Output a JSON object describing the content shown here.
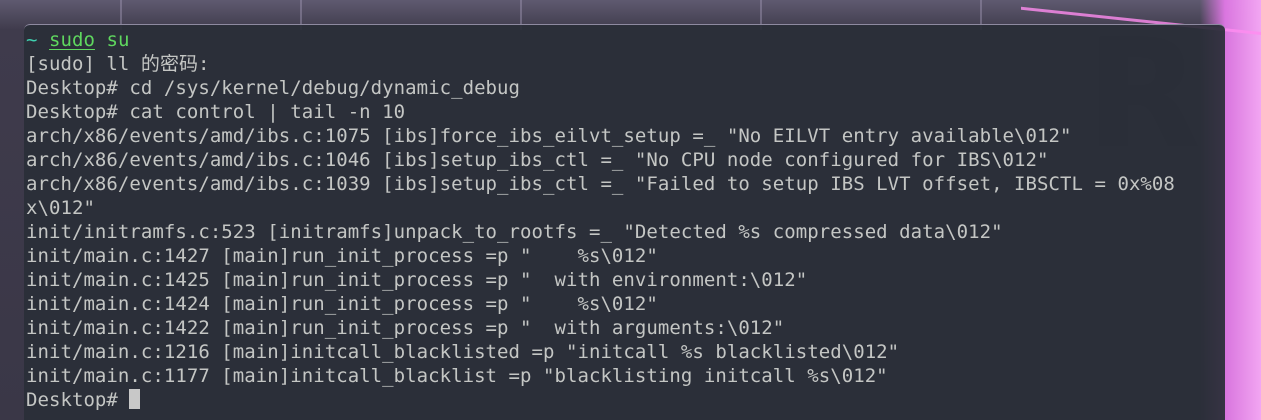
{
  "terminal": {
    "first_line": {
      "prompt": "~",
      "command": "sudo",
      "argument": "su"
    },
    "lines": [
      "[sudo] ll 的密码:",
      "Desktop# cd /sys/kernel/debug/dynamic_debug",
      "Desktop# cat control | tail -n 10",
      "arch/x86/events/amd/ibs.c:1075 [ibs]force_ibs_eilvt_setup =_ \"No EILVT entry available\\012\"",
      "arch/x86/events/amd/ibs.c:1046 [ibs]setup_ibs_ctl =_ \"No CPU node configured for IBS\\012\"",
      "arch/x86/events/amd/ibs.c:1039 [ibs]setup_ibs_ctl =_ \"Failed to setup IBS LVT offset, IBSCTL = 0x%08",
      "x\\012\"",
      "init/initramfs.c:523 [initramfs]unpack_to_rootfs =_ \"Detected %s compressed data\\012\"",
      "init/main.c:1427 [main]run_init_process =p \"    %s\\012\"",
      "init/main.c:1425 [main]run_init_process =p \"  with environment:\\012\"",
      "init/main.c:1424 [main]run_init_process =p \"    %s\\012\"",
      "init/main.c:1422 [main]run_init_process =p \"  with arguments:\\012\"",
      "init/main.c:1216 [main]initcall_blacklisted =p \"initcall %s blacklisted\\012\"",
      "init/main.c:1177 [main]initcall_blacklist =p \"blacklisting initcall %s\\012\""
    ],
    "current_prompt": "Desktop# ",
    "colors": {
      "background": "#2a2e38",
      "text": "#c4c6c4",
      "prompt_tilde": "#3fd1b0",
      "command": "#5fd75f",
      "wallpaper_accent": "#f2a6f2"
    }
  }
}
